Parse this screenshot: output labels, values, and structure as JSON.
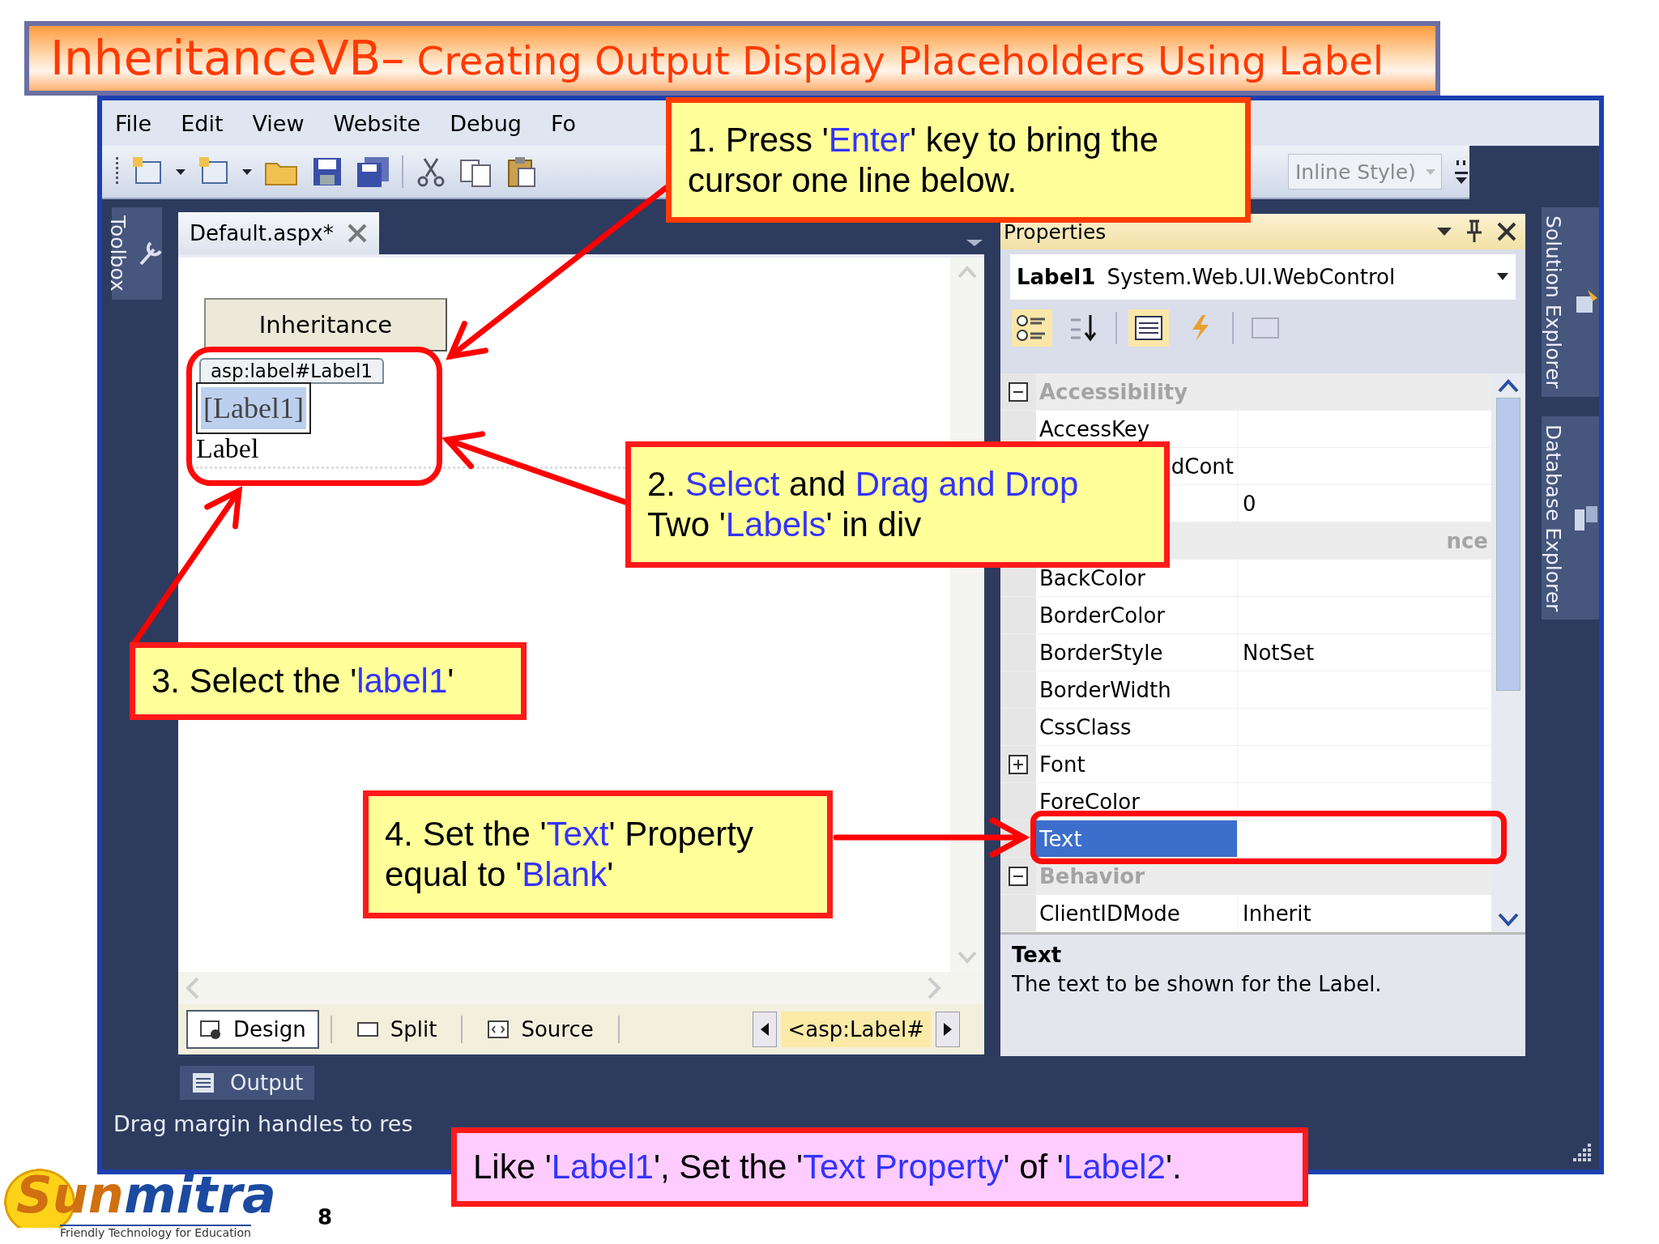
{
  "slide": {
    "title_lead": "InheritanceVB–",
    "title_rest": " Creating Output Display Placeholders Using Label",
    "page_number": "8",
    "logo_first": "Sun",
    "logo_rest": "mitra",
    "logo_tagline": "Friendly Technology for Education"
  },
  "ide": {
    "menu": [
      "File",
      "Edit",
      "View",
      "Website",
      "Debug",
      "Fo"
    ],
    "style_box": "Inline Style)",
    "toolbox_tab": "Toolbox",
    "right_tabs": [
      "Solution Explorer",
      "Database Explorer"
    ],
    "document_tab": "Default.aspx*",
    "design": {
      "button": "Inheritance",
      "tag": "asp:label#Label1",
      "label1": "[Label1]",
      "label2": "Label"
    },
    "views": [
      {
        "label": "Design",
        "selected": true
      },
      {
        "label": "Split",
        "selected": false
      },
      {
        "label": "Source",
        "selected": false
      }
    ],
    "breadcrumb": "<asp:Label#",
    "output_tab": "Output",
    "status": "Drag margin handles to res"
  },
  "properties": {
    "title": "Properties",
    "object_name": "Label1",
    "object_type": "System.Web.UI.WebControl",
    "rows": [
      {
        "kind": "category",
        "name": "Accessibility",
        "expanded": true,
        "selected": false
      },
      {
        "kind": "property",
        "name": "AccessKey",
        "selected": false
      },
      {
        "kind": "covered",
        "name": "dCont",
        "selected": false
      },
      {
        "kind": "covered",
        "value": "0",
        "selected": false
      },
      {
        "kind": "covered_category",
        "name": "nce",
        "selected": false
      },
      {
        "kind": "property",
        "name": "BackColor",
        "selected": false
      },
      {
        "kind": "property",
        "name": "BorderColor",
        "selected": false
      },
      {
        "kind": "property",
        "name": "BorderStyle",
        "value": "NotSet",
        "selected": false
      },
      {
        "kind": "property",
        "name": "BorderWidth",
        "selected": false
      },
      {
        "kind": "property",
        "name": "CssClass",
        "selected": false
      },
      {
        "kind": "expandable",
        "name": "Font",
        "expanded": false,
        "selected": false
      },
      {
        "kind": "property",
        "name": "ForeColor",
        "selected": false
      },
      {
        "kind": "property",
        "name": "Text",
        "selected": true
      },
      {
        "kind": "category",
        "name": "Behavior",
        "expanded": true,
        "selected": false
      },
      {
        "kind": "property",
        "name": "ClientIDMode",
        "value": "Inherit",
        "selected": false
      }
    ],
    "description_title": "Text",
    "description": "The text to be shown for the Label."
  },
  "callouts": [
    {
      "kind": "note",
      "lines": [
        [
          {
            "text": "1. Press '",
            "highlight": false
          },
          {
            "text": "Enter",
            "highlight": true
          },
          {
            "text": "' key to bring the",
            "highlight": false
          }
        ],
        [
          {
            "text": "cursor one line below.",
            "highlight": false
          }
        ]
      ]
    },
    {
      "kind": "note",
      "lines": [
        [
          {
            "text": "2. ",
            "highlight": false
          },
          {
            "text": "Select",
            "highlight": true
          },
          {
            "text": " and ",
            "highlight": false
          },
          {
            "text": "Drag and Drop",
            "highlight": true
          }
        ],
        [
          {
            "text": "Two '",
            "highlight": false
          },
          {
            "text": "Labels",
            "highlight": true
          },
          {
            "text": "' in div",
            "highlight": false
          }
        ]
      ]
    },
    {
      "kind": "note",
      "lines": [
        [
          {
            "text": "3. Select the '",
            "highlight": false
          },
          {
            "text": "label1",
            "highlight": true
          },
          {
            "text": "'",
            "highlight": false
          }
        ]
      ]
    },
    {
      "kind": "note",
      "lines": [
        [
          {
            "text": "4. Set the '",
            "highlight": false
          },
          {
            "text": "Text",
            "highlight": true
          },
          {
            "text": "' Property",
            "highlight": false
          }
        ],
        [
          {
            "text": "equal to '",
            "highlight": false
          },
          {
            "text": "Blank",
            "highlight": true
          },
          {
            "text": "'",
            "highlight": false
          }
        ]
      ]
    },
    {
      "kind": "summary",
      "lines": [
        [
          {
            "text": "Like '",
            "highlight": false
          },
          {
            "text": "Label1",
            "highlight": true
          },
          {
            "text": "', Set the '",
            "highlight": false
          },
          {
            "text": "Text Property",
            "highlight": true
          },
          {
            "text": "' of '",
            "highlight": false
          },
          {
            "text": "Label2",
            "highlight": true
          },
          {
            "text": "'.",
            "highlight": false
          }
        ]
      ]
    }
  ]
}
